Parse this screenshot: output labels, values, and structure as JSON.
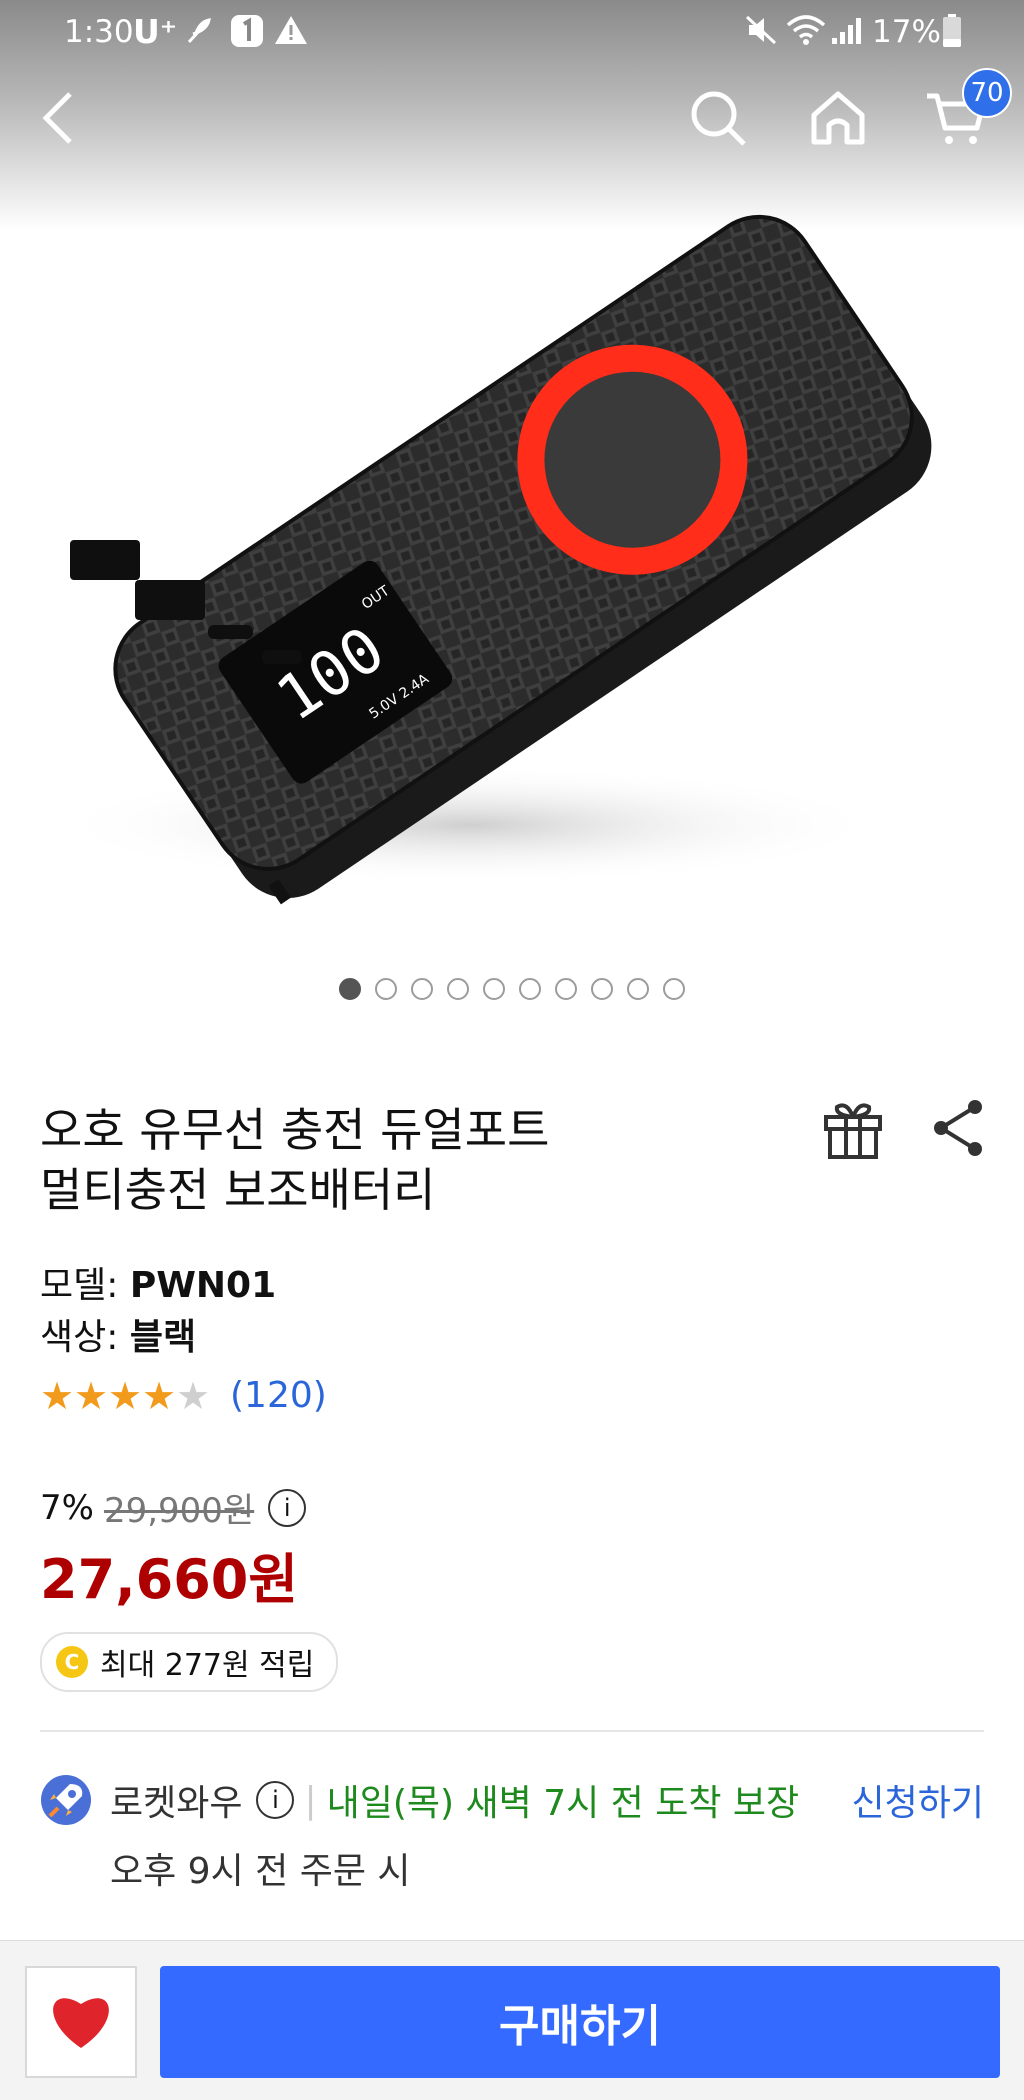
{
  "status_bar": {
    "time": "1:30",
    "carrier": "U⁺",
    "battery_percent": "17%",
    "accent_color": "#2f6fea"
  },
  "nav": {
    "back_icon": "chevron-left-icon",
    "search_icon": "search-icon",
    "home_icon": "home-icon",
    "cart_icon": "cart-icon",
    "cart_count": "70"
  },
  "gallery": {
    "current_index": 1,
    "total": 10,
    "display": {
      "percent": "100",
      "out_label": "OUT",
      "spec": "5.0V 2.4A"
    }
  },
  "product": {
    "title_line1": "오호 유무선 충전 듀얼포트",
    "title_line2": "멀티충전 보조배터리",
    "model_label": "모델:",
    "model_value": "PWN01",
    "color_label": "색상:",
    "color_value": "블랙",
    "rating": 4,
    "rating_max": 5,
    "review_count": "(120)",
    "discount": "7%",
    "original_price": "29,900원",
    "sale_price": "27,660원",
    "cashback_coin": "C",
    "cashback_text": "최대 277원 적립"
  },
  "delivery": {
    "rocket_label": "로켓와우",
    "info_symbol": "i",
    "separator": "|",
    "promise": "내일(목) 새벽 7시 전 도착 보장",
    "apply": "신청하기",
    "order_note": "오후 9시 전 주문 시"
  },
  "bottom_bar": {
    "wish_icon": "heart-icon",
    "buy_label": "구매하기",
    "buy_color": "#346aff",
    "heart_color": "#e0242b"
  }
}
